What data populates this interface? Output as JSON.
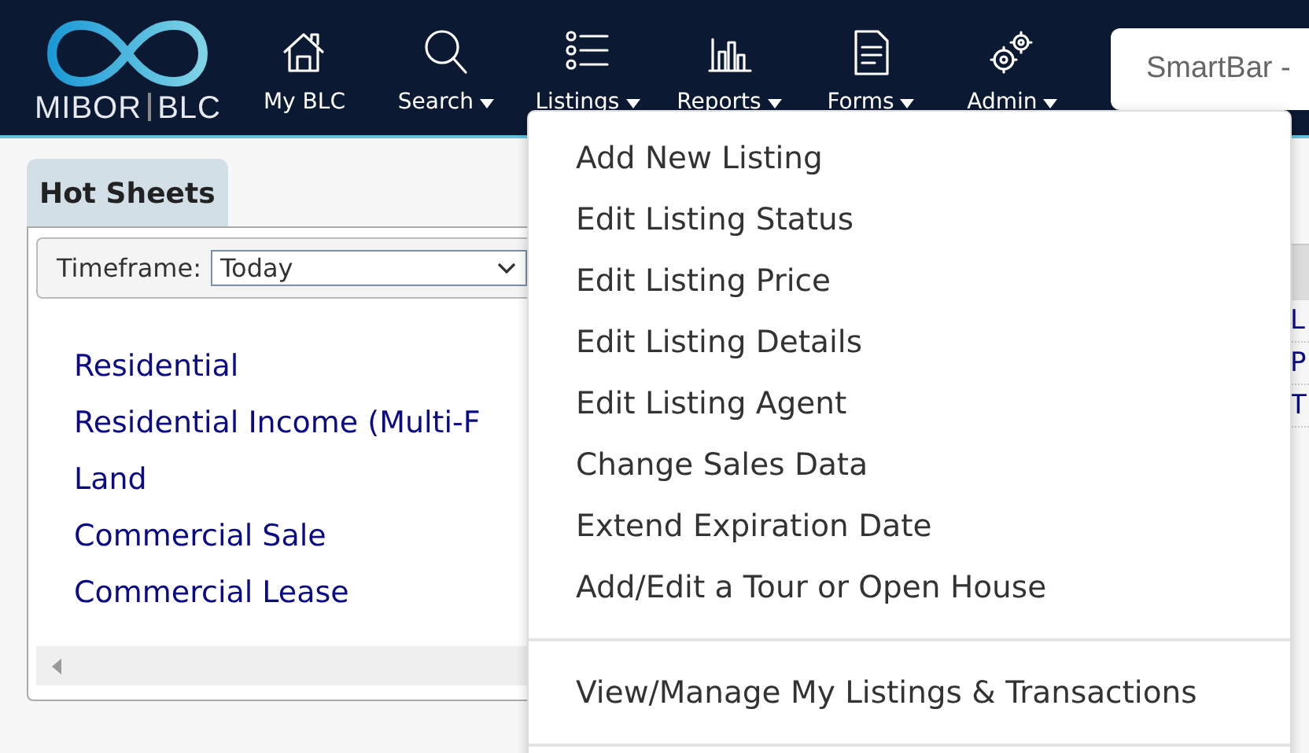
{
  "logo": {
    "left": "MIBOR",
    "right": "BLC"
  },
  "nav": [
    {
      "label": "My BLC",
      "kind": "home",
      "caret": false
    },
    {
      "label": "Search",
      "kind": "search",
      "caret": true
    },
    {
      "label": "Listings",
      "kind": "list",
      "caret": true
    },
    {
      "label": "Reports",
      "kind": "chart",
      "caret": true
    },
    {
      "label": "Forms",
      "kind": "document",
      "caret": true
    },
    {
      "label": "Admin",
      "kind": "gears",
      "caret": true
    }
  ],
  "smartbar": {
    "placeholder": "SmartBar -"
  },
  "hot_sheets": {
    "tab": "Hot Sheets",
    "timeframe_label": "Timeframe:",
    "timeframe_value": "Today",
    "links": [
      "Residential",
      "Residential Income (Multi-F",
      "Land",
      "Commercial Sale",
      "Commercial Lease"
    ]
  },
  "right_panel": {
    "rows": [
      "L",
      "P",
      "T"
    ]
  },
  "listings_menu": {
    "groups": [
      [
        "Add New Listing",
        "Edit Listing Status",
        "Edit Listing Price",
        "Edit Listing Details",
        "Edit Listing Agent",
        "Change Sales Data",
        "Extend Expiration Date",
        "Add/Edit a Tour or Open House"
      ],
      [
        "View/Manage My Listings & Transactions"
      ]
    ]
  }
}
